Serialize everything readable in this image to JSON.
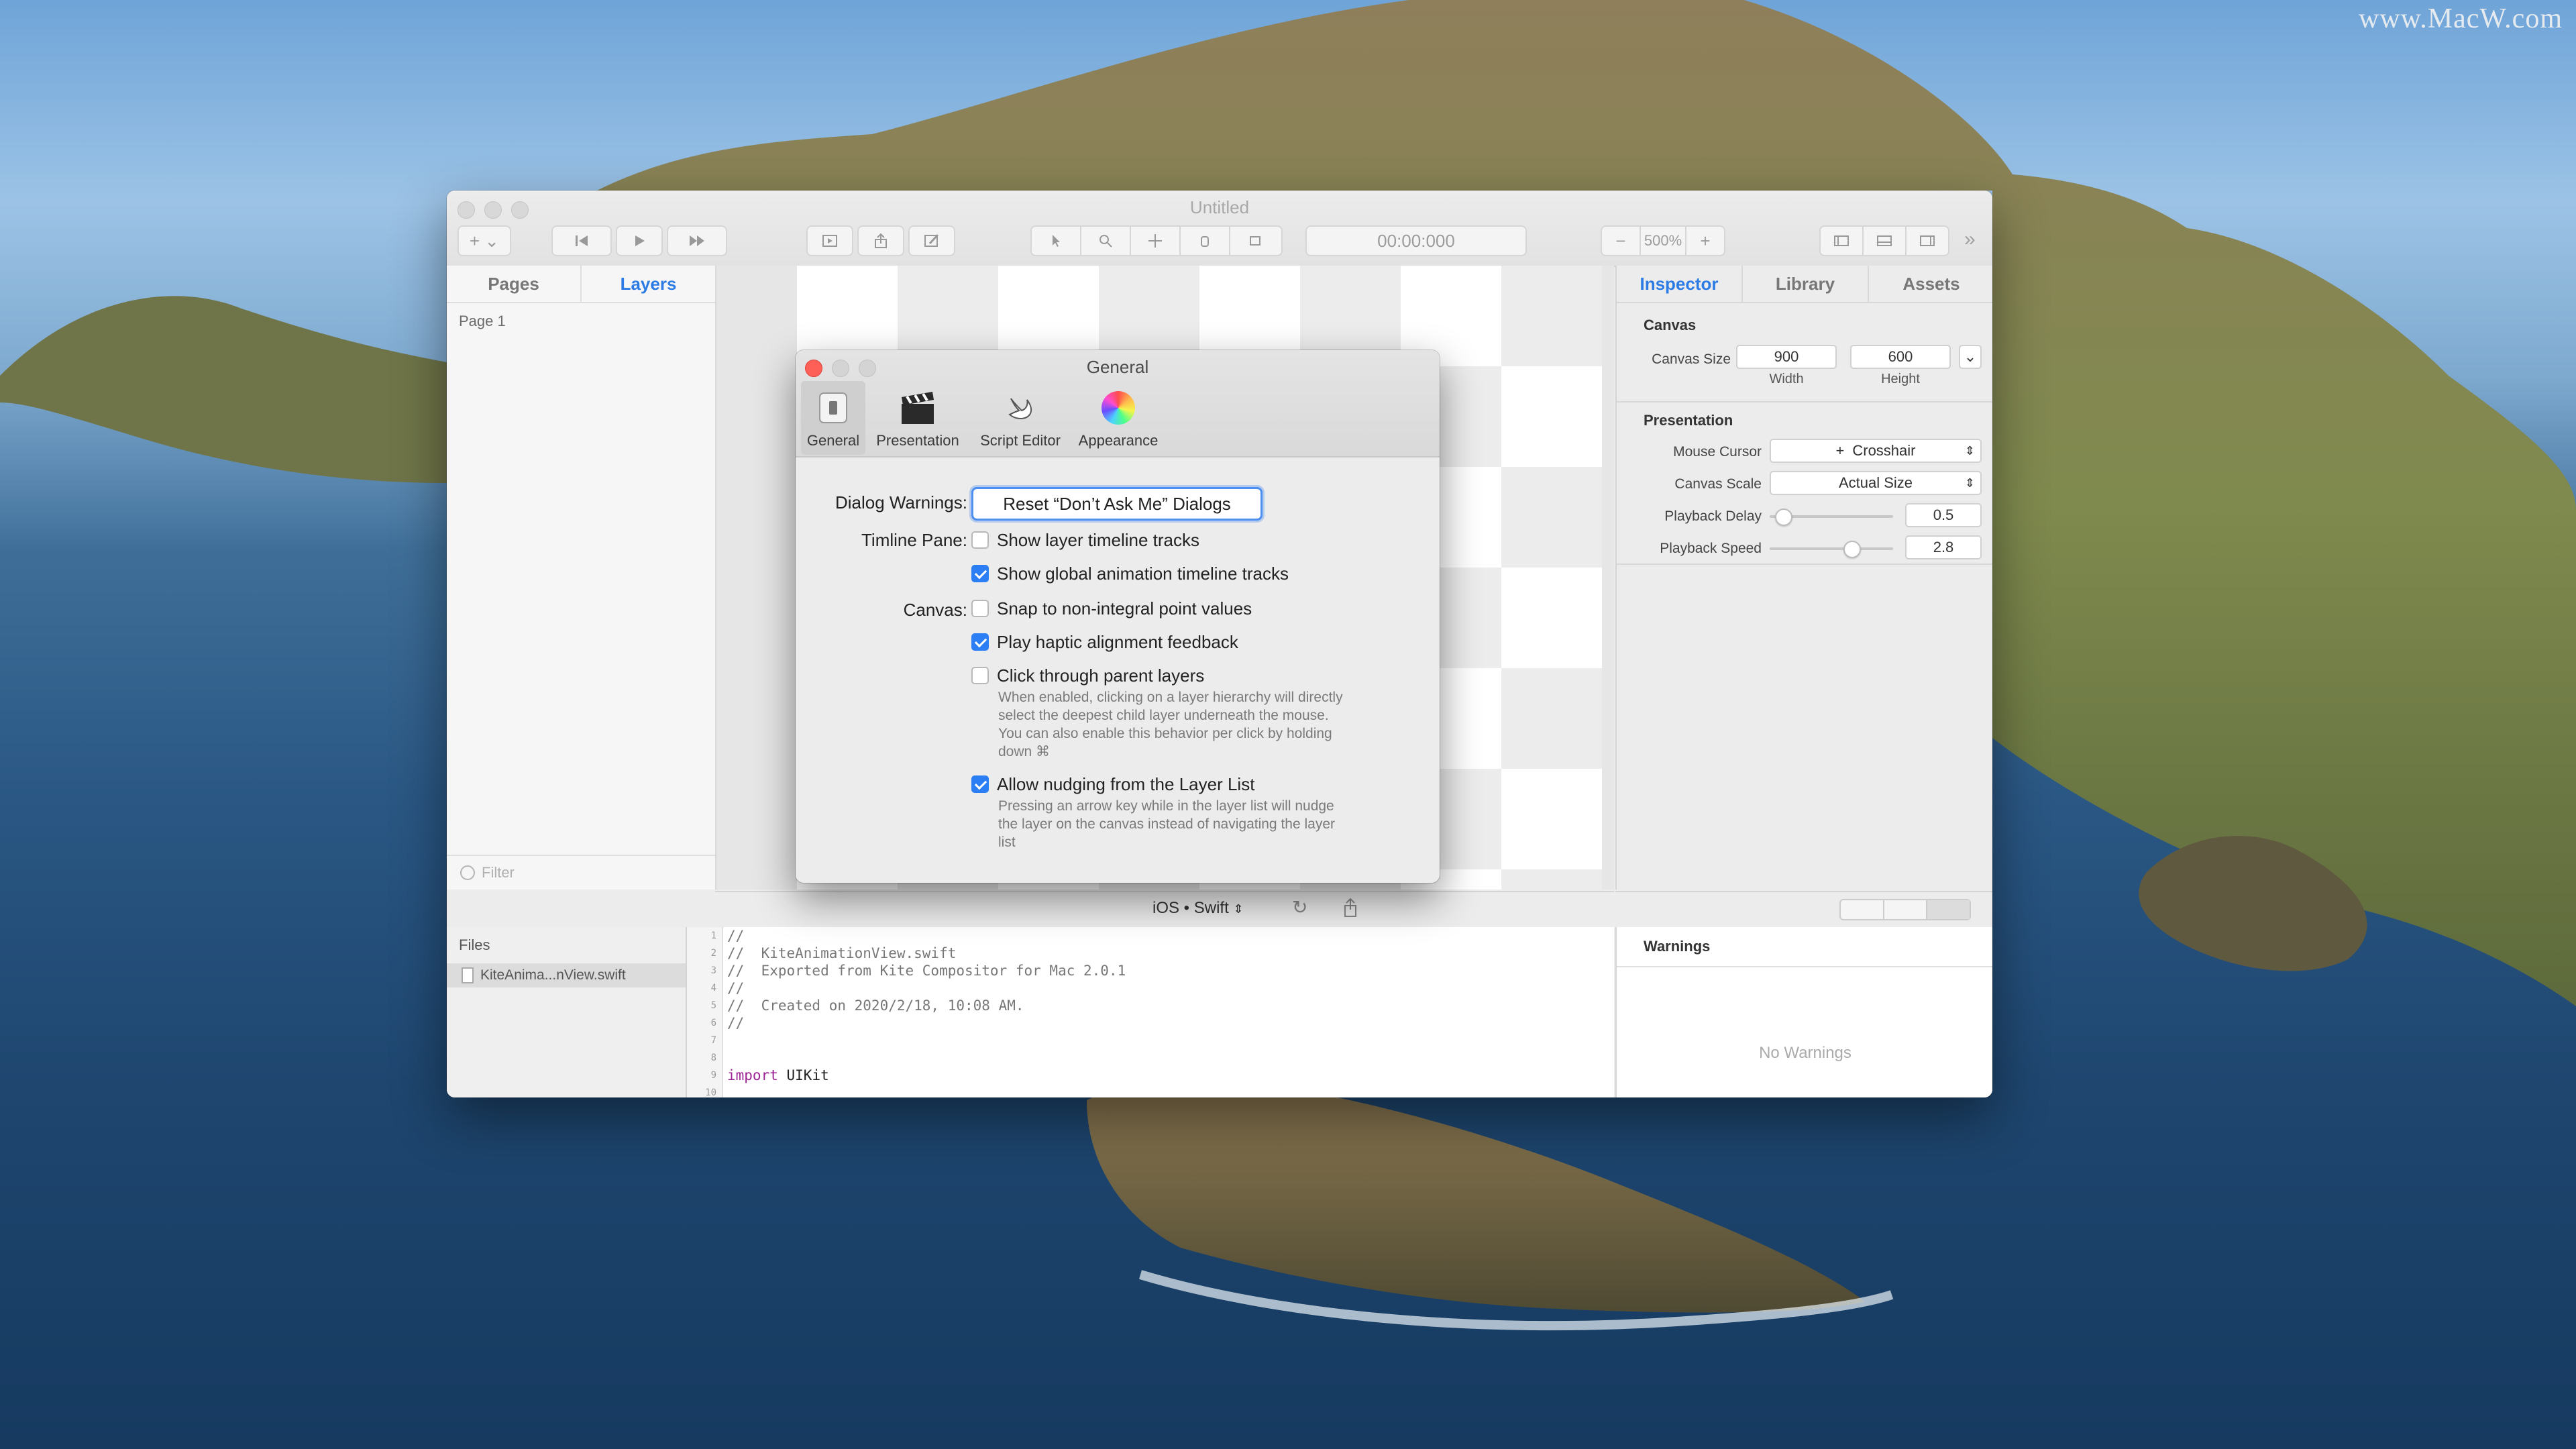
{
  "watermark": "www.MacW.com",
  "window": {
    "title": "Untitled",
    "timecode": "00:00:000",
    "zoom": "500%"
  },
  "left_pane": {
    "tabs": [
      "Pages",
      "Layers"
    ],
    "active_tab": "Layers",
    "pages": [
      "Page 1"
    ],
    "filter_placeholder": "Filter"
  },
  "inspector": {
    "tabs": [
      "Inspector",
      "Library",
      "Assets"
    ],
    "active_tab": "Inspector",
    "canvas_section": "Canvas",
    "canvas_size_label": "Canvas Size",
    "width_value": "900",
    "width_label": "Width",
    "height_value": "600",
    "height_label": "Height",
    "presentation_section": "Presentation",
    "mouse_cursor_label": "Mouse Cursor",
    "mouse_cursor_value": "Crosshair",
    "canvas_scale_label": "Canvas Scale",
    "canvas_scale_value": "Actual Size",
    "playback_delay_label": "Playback Delay",
    "playback_delay_value": "0.5",
    "playback_speed_label": "Playback Speed",
    "playback_speed_value": "2.8"
  },
  "bottom": {
    "platform_select": "iOS • Swift",
    "files_header": "Files",
    "file_name": "KiteAnima...nView.swift",
    "warnings_header": "Warnings",
    "no_warnings": "No Warnings",
    "code_lines": [
      "//",
      "//  KiteAnimationView.swift",
      "//  Exported from Kite Compositor for Mac 2.0.1",
      "//",
      "//  Created on 2020/2/18, 10:08 AM.",
      "//",
      "",
      "",
      "import UIKit",
      ""
    ],
    "line_numbers": [
      "1",
      "2",
      "3",
      "4",
      "5",
      "6",
      "7",
      "8",
      "9",
      "10"
    ]
  },
  "dialog": {
    "title": "General",
    "toolbar": [
      "General",
      "Presentation",
      "Script Editor",
      "Appearance"
    ],
    "selected": "General",
    "dialog_warnings_label": "Dialog Warnings:",
    "reset_button": "Reset  “Don’t Ask Me” Dialogs",
    "timeline_label": "Timline Pane:",
    "canvas_label": "Canvas:",
    "options": [
      {
        "label": "Show layer timeline tracks",
        "checked": false
      },
      {
        "label": "Show global animation timeline tracks",
        "checked": true
      },
      {
        "label": "Snap to non-integral point values",
        "checked": false
      },
      {
        "label": "Play haptic alignment feedback",
        "checked": true
      },
      {
        "label": "Click through parent layers",
        "checked": false
      },
      {
        "label": "Allow nudging from the Layer List",
        "checked": true
      }
    ],
    "click_through_desc": "When enabled, clicking on a layer hierarchy will directly select the deepest child layer underneath the mouse. You can also enable this behavior per click by holding down ⌘",
    "nudge_desc": "Pressing an arrow key while in the layer list will nudge the layer on the canvas instead of navigating the layer list"
  },
  "colors": {
    "accent": "#2c7be5",
    "checkbox_on": "#2b7ef3",
    "close_red": "#fe5f57"
  }
}
